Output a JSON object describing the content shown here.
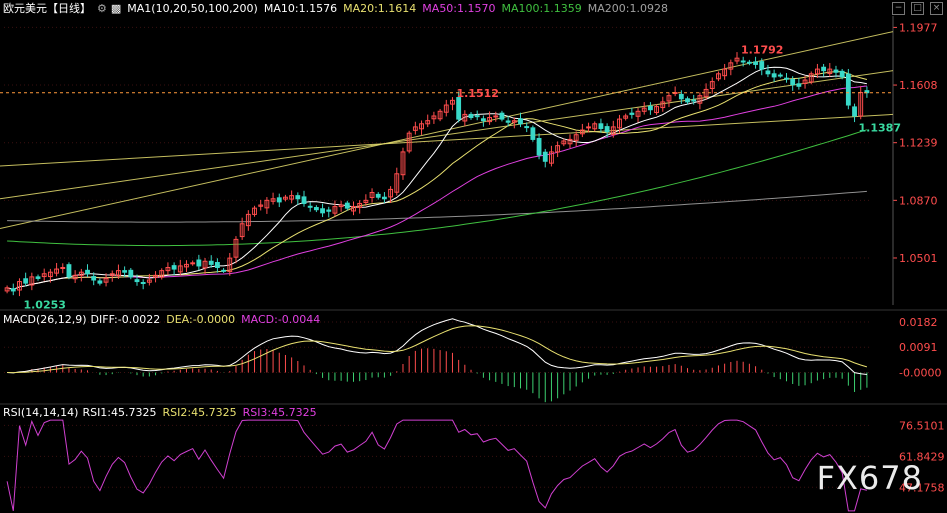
{
  "header": {
    "symbol": "欧元美元",
    "period": "【日线】",
    "gear_icon": "settings-gear-icon",
    "ma_icon": "indicator-icon",
    "ma_label": "MA1(10,20,50,100,200)",
    "ma10": "MA10:1.1576",
    "ma20": "MA20:1.1614",
    "ma50": "MA50:1.1570",
    "ma100": "MA100:1.1359",
    "ma200": "MA200:1.0928"
  },
  "toolbar": {
    "icons": [
      "minimize-icon",
      "maximize-icon",
      "close-icon"
    ],
    "glyphs": [
      "−",
      "□",
      "×"
    ]
  },
  "macd_header": {
    "label": "MACD(26,12,9)",
    "diff": "DIFF:-0.0022",
    "dea": "DEA:-0.0000",
    "macd": "MACD:-0.0044"
  },
  "rsi_header": {
    "label": "RSI(14,14,14)",
    "rsi1": "RSI1:45.7325",
    "rsi2": "RSI2:45.7325",
    "rsi3": "RSI3:45.7325"
  },
  "watermark": "FX678",
  "colors": {
    "up": "#ff4d4d",
    "down": "#39d9c8",
    "ma10": "#ffffff",
    "ma20": "#e8e070",
    "ma50": "#e040e0",
    "ma100": "#40c040",
    "ma200": "#909090",
    "channel": "#e8e070",
    "rsi": "#d040d0",
    "price_line": "#ff9a3c"
  },
  "chart_data": {
    "type": "candlestick",
    "price_axis": {
      "ticks": [
        "1.1977",
        "1.1608",
        "1.1239",
        "1.0870",
        "1.0501"
      ],
      "ylim": [
        1.02,
        1.205
      ]
    },
    "current_price": 1.1559,
    "annotations": [
      {
        "label": "1.0253",
        "value": 1.0253,
        "kind": "low"
      },
      {
        "label": "1.1512",
        "value": 1.1512,
        "kind": "high"
      },
      {
        "label": "1.1792",
        "value": 1.1792,
        "kind": "high"
      },
      {
        "label": "1.1387",
        "value": 1.1387,
        "kind": "low"
      }
    ],
    "closes": [
      1.031,
      1.029,
      1.035,
      1.034,
      1.038,
      1.037,
      1.04,
      1.041,
      1.043,
      1.044,
      1.038,
      1.039,
      1.041,
      1.04,
      1.036,
      1.034,
      1.037,
      1.04,
      1.042,
      1.041,
      1.038,
      1.035,
      1.034,
      1.036,
      1.039,
      1.042,
      1.044,
      1.043,
      1.045,
      1.046,
      1.047,
      1.045,
      1.048,
      1.046,
      1.044,
      1.042,
      1.05,
      1.062,
      1.072,
      1.078,
      1.082,
      1.084,
      1.087,
      1.088,
      1.086,
      1.089,
      1.09,
      1.088,
      1.085,
      1.083,
      1.081,
      1.079,
      1.08,
      1.083,
      1.084,
      1.082,
      1.083,
      1.085,
      1.087,
      1.092,
      1.089,
      1.088,
      1.094,
      1.104,
      1.118,
      1.13,
      1.134,
      1.136,
      1.138,
      1.141,
      1.144,
      1.148,
      1.151,
      1.139,
      1.142,
      1.14,
      1.141,
      1.138,
      1.14,
      1.141,
      1.139,
      1.137,
      1.138,
      1.136,
      1.134,
      1.126,
      1.116,
      1.112,
      1.118,
      1.122,
      1.125,
      1.126,
      1.129,
      1.132,
      1.134,
      1.136,
      1.133,
      1.131,
      1.134,
      1.139,
      1.141,
      1.142,
      1.144,
      1.146,
      1.145,
      1.147,
      1.15,
      1.154,
      1.156,
      1.152,
      1.15,
      1.151,
      1.154,
      1.158,
      1.163,
      1.168,
      1.171,
      1.175,
      1.178,
      1.176,
      1.175,
      1.174,
      1.171,
      1.168,
      1.166,
      1.167,
      1.165,
      1.161,
      1.16,
      1.164,
      1.168,
      1.171,
      1.17,
      1.171,
      1.169,
      1.166,
      1.148,
      1.141,
      1.156,
      1.1559
    ],
    "ma_last": {
      "MA10": 1.1576,
      "MA20": 1.1614,
      "MA50": 1.157,
      "MA100": 1.1359,
      "MA200": 1.0928
    },
    "macd_axis": {
      "ticks": [
        "0.0182",
        "0.0091",
        "-0.0000"
      ]
    },
    "rsi_axis": {
      "ticks": [
        "76.5101",
        "61.8429",
        "47.1758"
      ]
    },
    "rsi_last": 45.7325
  }
}
